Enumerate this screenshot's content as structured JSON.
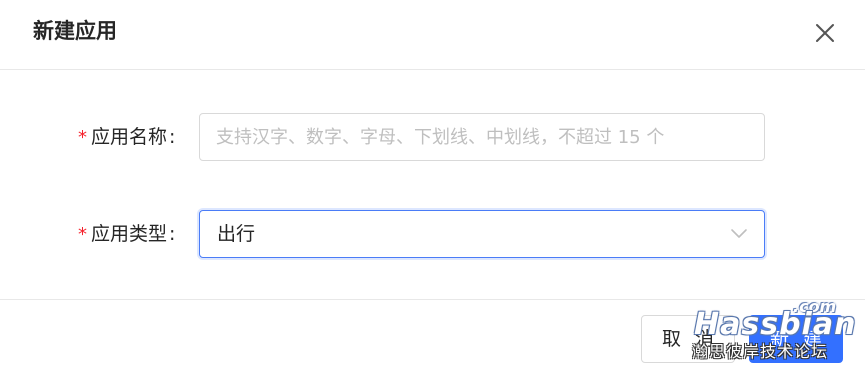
{
  "dialog": {
    "title": "新建应用",
    "close_icon": "close-icon"
  },
  "form": {
    "app_name": {
      "required_mark": "*",
      "label": "应用名称",
      "colon": ":",
      "value": "",
      "placeholder": "支持汉字、数字、字母、下划线、中划线，不超过 15 个"
    },
    "app_type": {
      "required_mark": "*",
      "label": "应用类型",
      "colon": ":",
      "value": "出行",
      "arrow_icon": "chevron-down-icon"
    }
  },
  "footer": {
    "cancel_label": "取消",
    "create_label": "新建"
  },
  "watermark": {
    "domain": ".com",
    "brand": "Hassbian",
    "subtitle": "瀚思彼岸技术论坛"
  },
  "colors": {
    "primary": "#3370ff",
    "required": "#f5222d",
    "border": "#d9d9d9",
    "focus_border": "#4a7cf7"
  }
}
